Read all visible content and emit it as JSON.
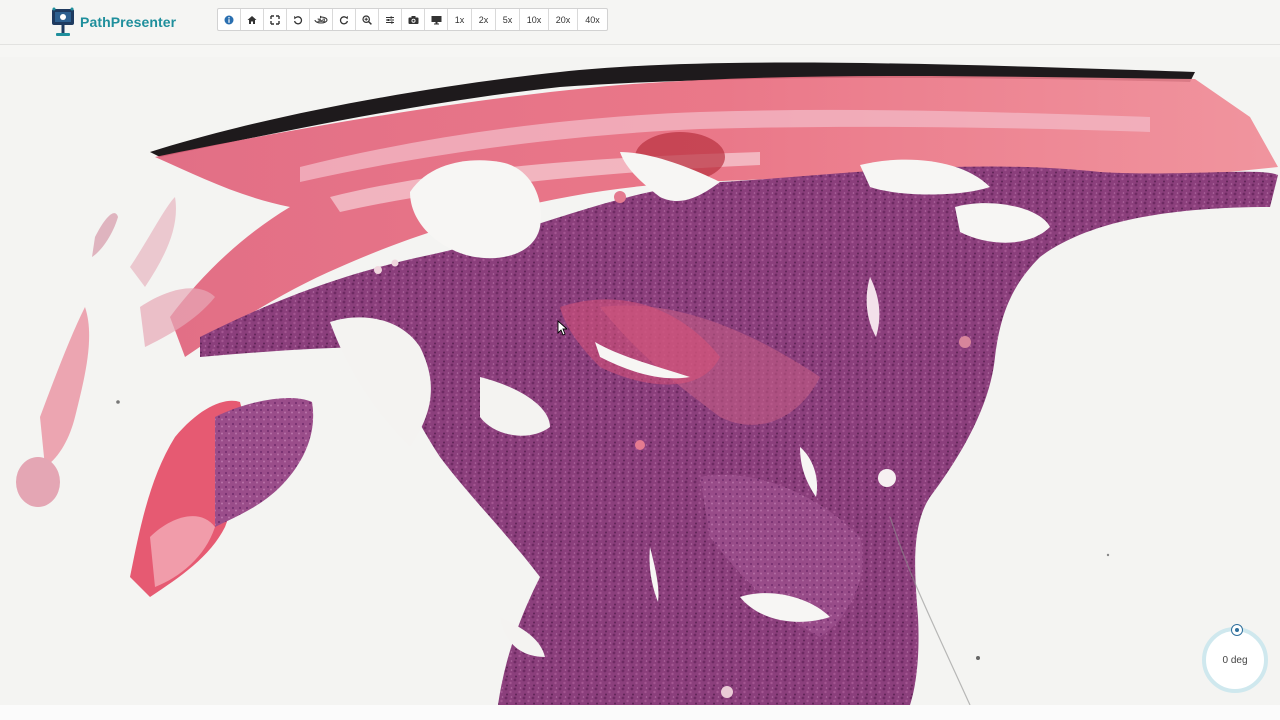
{
  "app": {
    "name": "PathPresenter"
  },
  "toolbar": {
    "buttons": [
      {
        "id": "info",
        "icon": "info-icon",
        "active": true
      },
      {
        "id": "home",
        "icon": "home-icon"
      },
      {
        "id": "fullscreen",
        "icon": "fullscreen-icon"
      },
      {
        "id": "rotate-left",
        "icon": "rotate-left-icon"
      },
      {
        "id": "rotate-360",
        "icon": "rotate-360-icon"
      },
      {
        "id": "rotate-right",
        "icon": "rotate-right-icon"
      },
      {
        "id": "zoom-in",
        "icon": "zoom-in-icon"
      },
      {
        "id": "adjust",
        "icon": "sliders-icon"
      },
      {
        "id": "snapshot",
        "icon": "camera-icon"
      },
      {
        "id": "display",
        "icon": "monitor-icon"
      }
    ],
    "zoom_levels": [
      "1x",
      "2x",
      "5x",
      "10x",
      "20x",
      "40x"
    ]
  },
  "rotation": {
    "label": "0 deg"
  },
  "colors": {
    "accent": "#1f8f9c",
    "eosin": "#e0556a",
    "hematoxylin": "#8a3b78",
    "background": "#f4f4f2"
  }
}
